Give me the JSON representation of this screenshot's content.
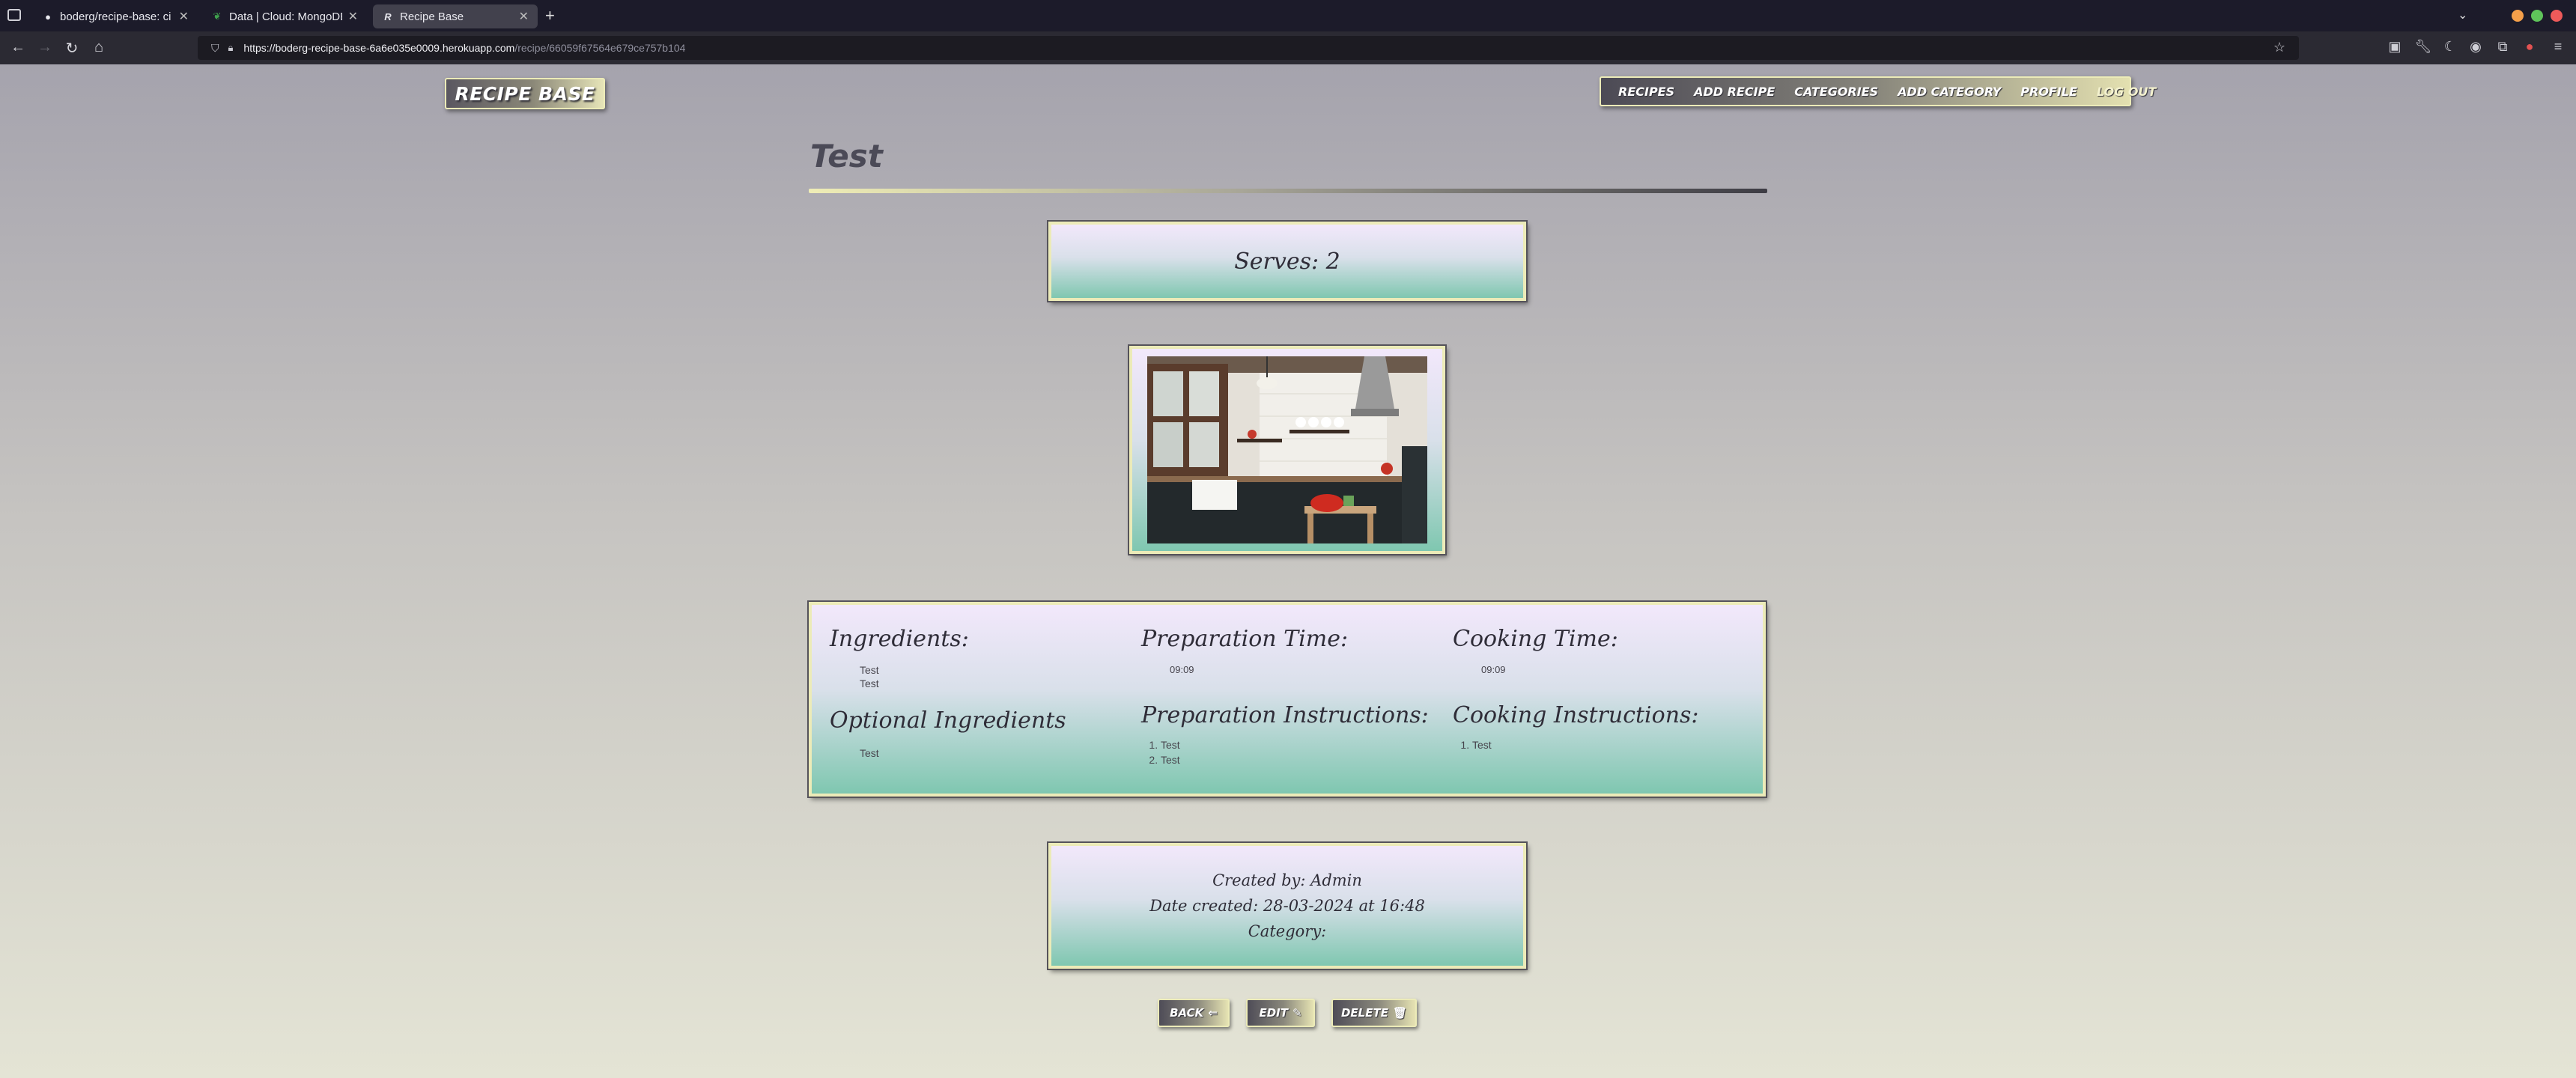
{
  "browser": {
    "tabs": [
      {
        "title": "boderg/recipe-base: ci mile",
        "favicon": "github-icon",
        "active": false
      },
      {
        "title": "Data | Cloud: MongoDB Clo",
        "favicon": "mongodb-leaf-icon",
        "active": false
      },
      {
        "title": "Recipe Base",
        "favicon": "recipe-base-r-icon",
        "active": true
      }
    ],
    "url_host": "https://boderg-recipe-base-6a6e035e0009.herokuapp.com",
    "url_path": "/recipe/66059f67564e679ce757b104"
  },
  "site": {
    "brand": "RECIPE BASE",
    "menu": [
      "RECIPES",
      "ADD RECIPE",
      "CATEGORIES",
      "ADD CATEGORY",
      "PROFILE",
      "LOG OUT"
    ]
  },
  "recipe": {
    "title": "Test",
    "serves": "Serves: 2",
    "ingredients_heading": "Ingredients:",
    "ingredients": [
      "Test",
      "Test"
    ],
    "optional_heading": "Optional Ingredients",
    "optional_ingredients": [
      "Test"
    ],
    "prep_time_heading": "Preparation Time:",
    "prep_time": "09:09",
    "prep_instructions_heading": "Preparation Instructions:",
    "prep_instructions": [
      "Test",
      "Test"
    ],
    "cook_time_heading": "Cooking Time:",
    "cook_time": "09:09",
    "cook_instructions_heading": "Cooking Instructions:",
    "cook_instructions": [
      "Test"
    ],
    "created_by": "Created by: Admin",
    "date_created": "Date created: 28-03-2024 at 16:48",
    "category": "Category:"
  },
  "actions": {
    "back": "BACK",
    "edit": "EDIT",
    "delete": "DELETE"
  },
  "colors": {
    "accent_border": "#ecebb8",
    "card_bottom": "#7fc7b0",
    "card_top": "#f2e8fb",
    "title": "#4b4a57"
  }
}
